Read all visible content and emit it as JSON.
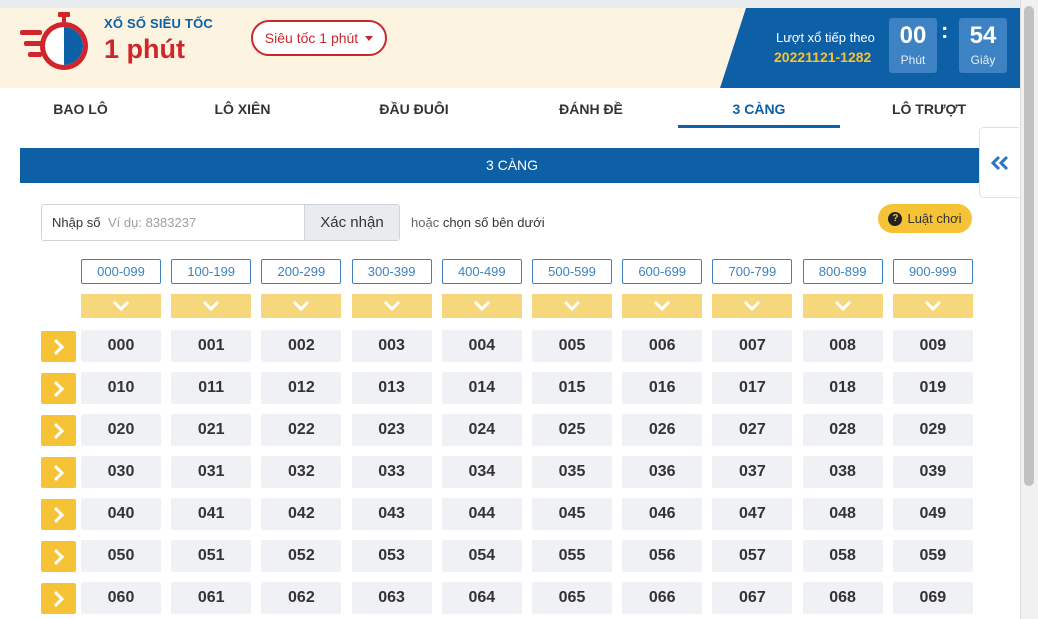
{
  "header": {
    "brand_top": "XỔ SỐ SIÊU TỐC",
    "brand_main": "1 phút",
    "game_select": "Siêu tốc 1 phút",
    "next_draw_label": "Lượt xổ tiếp theo",
    "draw_id": "20221121-1282",
    "minutes": "00",
    "minutes_label": "Phút",
    "seconds": "54",
    "seconds_label": "Giây",
    "colors": {
      "brand_blue": "#0d5fa6",
      "brand_red": "#d0262b",
      "accent_yellow": "#f6c236"
    }
  },
  "tabs": [
    {
      "label": "BAO LÔ",
      "active": false
    },
    {
      "label": "LÔ XIÊN",
      "active": false
    },
    {
      "label": "ĐẦU ĐUÔI",
      "active": false
    },
    {
      "label": "ĐÁNH ĐỀ",
      "active": false
    },
    {
      "label": "3 CÀNG",
      "active": true
    },
    {
      "label": "LÔ TRƯỢT",
      "active": false
    }
  ],
  "panel": {
    "title": "3 CÀNG",
    "input_label": "Nhập số",
    "input_placeholder": "Ví dụ: 8383237",
    "input_value": "",
    "confirm_button": "Xác nhận",
    "or_text": "hoặc",
    "choose_text": "chọn số bên dưới",
    "rules_button": "Luật chơi",
    "collapse_icon": "double-chevron-left-icon",
    "ranges": [
      "000-099",
      "100-199",
      "200-299",
      "300-399",
      "400-499",
      "500-599",
      "600-699",
      "700-799",
      "800-899",
      "900-999"
    ],
    "rows": [
      [
        "000",
        "001",
        "002",
        "003",
        "004",
        "005",
        "006",
        "007",
        "008",
        "009"
      ],
      [
        "010",
        "011",
        "012",
        "013",
        "014",
        "015",
        "016",
        "017",
        "018",
        "019"
      ],
      [
        "020",
        "021",
        "022",
        "023",
        "024",
        "025",
        "026",
        "027",
        "028",
        "029"
      ],
      [
        "030",
        "031",
        "032",
        "033",
        "034",
        "035",
        "036",
        "037",
        "038",
        "039"
      ],
      [
        "040",
        "041",
        "042",
        "043",
        "044",
        "045",
        "046",
        "047",
        "048",
        "049"
      ],
      [
        "050",
        "051",
        "052",
        "053",
        "054",
        "055",
        "056",
        "057",
        "058",
        "059"
      ],
      [
        "060",
        "061",
        "062",
        "063",
        "064",
        "065",
        "066",
        "067",
        "068",
        "069"
      ]
    ]
  }
}
